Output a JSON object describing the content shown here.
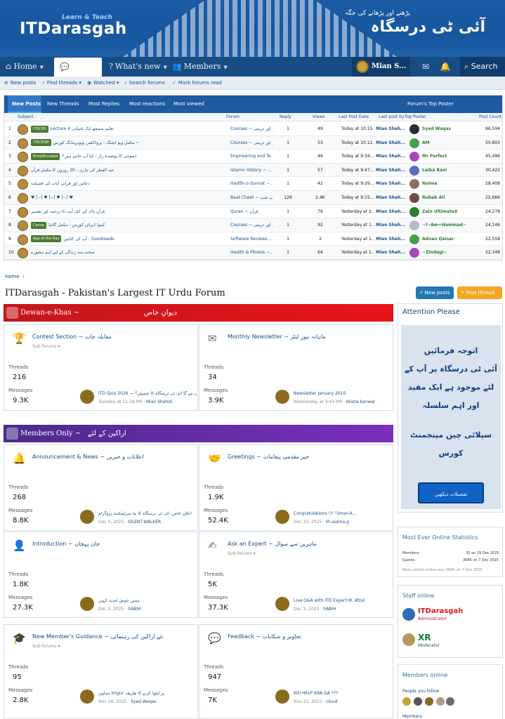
{
  "header": {
    "logo": "ITDarasgah",
    "logo_sub": "Learn & Teach",
    "logo_urdu": "آئی ٹی درسگاہ",
    "logo_urdu_sub": "پڑھنے اور پڑھانے کی جگہ"
  },
  "nav": {
    "home": "Home",
    "forums": "Forums",
    "whats_new": "What's new",
    "members": "Members",
    "user": "Mian S...",
    "search": "Search"
  },
  "subnav": {
    "new_posts": "New posts",
    "find_threads": "Find threads",
    "watched": "Watched",
    "search_forums": "Search forums",
    "mark_read": "Mark forums read"
  },
  "tabs": {
    "items": [
      "New Posts",
      "New Threads",
      "Most Replies",
      "Most reactions",
      "Most viewed"
    ],
    "top_posters": "Forum's Top Poster",
    "headers": {
      "subject": "Subject",
      "forum": "Forum",
      "reply": "Reply",
      "views": "Views",
      "last_date": "Last Post Date",
      "last_by": "Last post by",
      "top_poster": "Top Poster",
      "post_count": "Post Count"
    }
  },
  "rows": [
    {
      "n": "1",
      "badge": "ITDCPD",
      "title": "Lecture 4 تعلیم سمجھ ایک نامیاتی",
      "forum": "Courses ~ کورسز اور تربیتی",
      "reply": "1",
      "views": "49",
      "date": "Today at 10:15...",
      "by": "Mian Shah...",
      "tp": "Syed Waqas",
      "tpc": "96,594",
      "tpcolor": "#2b2b2b"
    },
    {
      "n": "2",
      "badge": "ITDCESM",
      "title": "مکمل ویو ایجنگ - پروڈکشن ویوبرینڈنگ کورس ~",
      "forum": "Courses ~ کورسز اور تربیتی",
      "reply": "1",
      "views": "53",
      "date": "Today at 10:11...",
      "by": "Mian Shah...",
      "tp": "AM",
      "tpc": "50,803",
      "tpcolor": "#43a047"
    },
    {
      "n": "3",
      "badge": "EmojiEncoded",
      "title": "ایموجی کا پوشیدہ راز - کیا آپ جانتے ہیں؟",
      "forum": "Engineering and Te...",
      "reply": "1",
      "views": "46",
      "date": "Today at 9:34...",
      "by": "Mian Shah...",
      "tp": "Mr Perfect",
      "tpc": "45,496",
      "tpcolor": "#ab47bc"
    },
    {
      "n": "4",
      "badge": "",
      "title": "عید الفطر کی تیاری - 30 روزوں کا مکمل قرآن",
      "forum": "Islamic History ~ ...",
      "reply": "1",
      "views": "57",
      "date": "Today at 9:47...",
      "by": "Mian Shah...",
      "tp": "Laiba Rani",
      "tpc": "30,422",
      "tpcolor": "#5c6bc0"
    },
    {
      "n": "5",
      "badge": "",
      "title": "دعائیں اور قرآنی آیات کی فضیلت",
      "forum": "Hadith-o-Sunnat ~...",
      "reply": "1",
      "views": "42",
      "date": "Today at 9:29...",
      "by": "Mian Shah...",
      "tp": "Naima",
      "tpc": "28,408",
      "tpcolor": "#8d6e63"
    },
    {
      "n": "6",
      "badge": "",
      "title": "♥ [--] ♥ [--] ♥ [--] ♥",
      "forum": "Baat Cheet ~ گپ شپ",
      "reply": "129",
      "views": "2.4K",
      "date": "Today at 9:15...",
      "by": "Mian Shah...",
      "tp": "Rubab Ali",
      "tpc": "25,666",
      "tpcolor": "#6d4c41"
    },
    {
      "n": "7",
      "badge": "",
      "title": "قرآن پاک کی ایک آیت کا ترجمہ اور تفسیر",
      "forum": "Quran ~ قرآن",
      "reply": "1",
      "views": "76",
      "date": "Yesterday at 2...",
      "by": "Mian Shah...",
      "tp": "Zain UltimateX",
      "tpc": "24,278",
      "tpcolor": "#2e7d32"
    },
    {
      "n": "8",
      "badge": "Canva",
      "title": "کینوا ڈیزائن کورس - مکمل گائیڈ",
      "forum": "Courses ~ کورسز اور تربیتی",
      "reply": "1",
      "views": "92",
      "date": "Yesterday at 1...",
      "by": "Mian Shah...",
      "tp": "~l~Am+Hammad~",
      "tpc": "24,146",
      "tpcolor": "#b0bec5"
    },
    {
      "n": "9",
      "badge": "App of the Day",
      "title": "آپ کی کتابیں - Goodreads",
      "forum": "Software Reviews ...",
      "reply": "1",
      "views": "2",
      "date": "Yesterday at 1...",
      "by": "Mian Shah...",
      "tp": "Adnan Qaisar",
      "tpc": "22,558",
      "tpcolor": "#43a047"
    },
    {
      "n": "10",
      "badge": "",
      "title": "صحت مند زندگی کے لیے اہم مشورے",
      "forum": "Health & Fitness ~...",
      "reply": "1",
      "views": "64",
      "date": "Yesterday at 1...",
      "by": "Mian Shah...",
      "tp": "~Zindagi~",
      "tpc": "22,348",
      "tpcolor": "#ab47bc"
    }
  ],
  "breadcrumb": "Home",
  "page_title": "ITDarasgah - Pakistan's Largest IT Urdu Forum",
  "buttons": {
    "new_posts": "New posts",
    "post_thread": "Post thread..."
  },
  "cat1": {
    "title": "Dewan-e-Khas ~",
    "urdu": "دیوانِ خاص"
  },
  "cat2": {
    "title": "Members Only ~",
    "urdu": "اراکین کے لئے"
  },
  "labels": {
    "threads": "Threads",
    "messages": "Messages",
    "subforums": "Sub-forums"
  },
  "forums": [
    {
      "title": "Contest Section ~",
      "urdu": "مقابلہ جات",
      "sub": true,
      "threads": "216",
      "messages": "9.3K",
      "last_title": "ITD Quiz 2026 — کون بنے گا آئی ٹی درسگاہ کا چیمپئن؟",
      "last_date": "Tuesday at 12:16 PM",
      "last_by": "Mian Shahid"
    },
    {
      "title": "Monthly Newsletter ~",
      "urdu": "ماہانہ نیوز لیٹر",
      "sub": false,
      "threads": "34",
      "messages": "3.9K",
      "last_title": "Newsletter January 2010",
      "last_date": "Wednesday at 3:43 PM",
      "last_by": "Alisha kanwal"
    },
    {
      "title": "Announcement & News ~",
      "urdu": "اعلانات و خبریں",
      "sub": false,
      "threads": "268",
      "messages": "8.8K",
      "last_title": "اعلانِ خاص: آئی ٹی درسگاہ کا نیا سرٹیفکیٹ پروگرام",
      "last_date": "Dec 5, 2025",
      "last_by": "SILENT.WALKER"
    },
    {
      "title": "Greetings ~",
      "urdu": "خیر مقدمی پیغامات",
      "sub": false,
      "threads": "1.9K",
      "messages": "52.4K",
      "last_title": "Congratulations !!! \"Umer-A...",
      "last_date": "Dec 10, 2025",
      "last_by": "M.usama.g"
    },
    {
      "title": "Introduction ~",
      "urdu": "جان پہچان",
      "sub": false,
      "threads": "1.8K",
      "messages": "27.3K",
      "last_title": "ہمیں خوش آمدید کہیں",
      "last_date": "Dec 5, 2025",
      "last_by": "SABIH"
    },
    {
      "title": "Ask an Expert ~",
      "urdu": "ماہرین سے سوال",
      "sub": true,
      "threads": "5K",
      "messages": "37.3K",
      "last_title": "Live Q&A with ITD Expert M. Afzal",
      "last_date": "Dec 3, 2025",
      "last_by": "SABIH"
    },
    {
      "title": "New Member's Guidance ~",
      "urdu": "نئے اراکین کی رہنمائی",
      "sub": true,
      "threads": "95",
      "messages": "2.8K",
      "last_title": "تصاویر Imgur پر اپلوڈ کرنے کا طریقہ",
      "last_date": "Nov 18, 2025",
      "last_by": "Syed Waqas"
    },
    {
      "title": "Feedback ~",
      "urdu": "تجاویز و شکایات",
      "sub": false,
      "threads": "947",
      "messages": "7K",
      "last_title": "KOI HELP KRA GA ???",
      "last_date": "Nov 23, 2015",
      "last_by": "cloud"
    }
  ],
  "sidebar": {
    "attention": "Attention Please",
    "ad_line1": "اتوجہ فرمائیں",
    "ad_line2": "آئی ٹی درسگاہ پر آپ کے",
    "ad_line3": "لئے موجود ہے ایک مفید",
    "ad_line4": "اور اہم سلسلہ",
    "ad_line5": "سپلائی چین مینجمنٹ",
    "ad_line6": "کورس",
    "ad_btn": "تفصیلات دیکھیں",
    "stats_title": "Most Ever Online Statistics",
    "members_lbl": "Members:",
    "members_val": "32 on 29 Dec 2025",
    "guests_lbl": "Guests:",
    "guests_val": "3680 on 7 Dec 2025",
    "visitors": "Most visitors online was 3695, on 7 Dec 2025",
    "staff_title": "Staff online",
    "staff1": "ITDarasgah",
    "staff1_role": "Administrator",
    "staff2": "XR",
    "staff2_role": "Moderator",
    "members_online": "Members online",
    "people_follow": "People you follow",
    "members_lbl2": "Members"
  }
}
